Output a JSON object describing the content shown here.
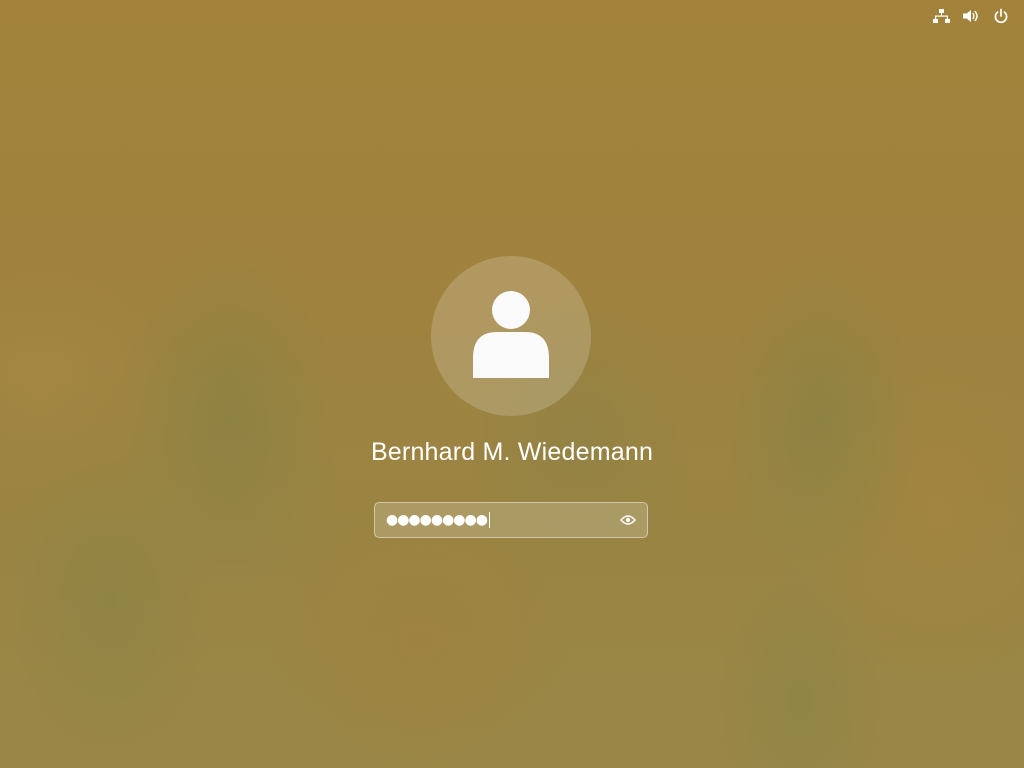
{
  "tray": {
    "icons": [
      "network-icon",
      "volume-icon",
      "power-icon"
    ]
  },
  "user": {
    "display_name": "Bernhard M. Wiedemann",
    "avatar_icon": "user-silhouette-icon"
  },
  "password": {
    "masked_value": "●●●●●●●●●",
    "reveal_icon": "eye-icon"
  },
  "colors": {
    "background": "#a0823c",
    "foreground": "#ffffff"
  }
}
